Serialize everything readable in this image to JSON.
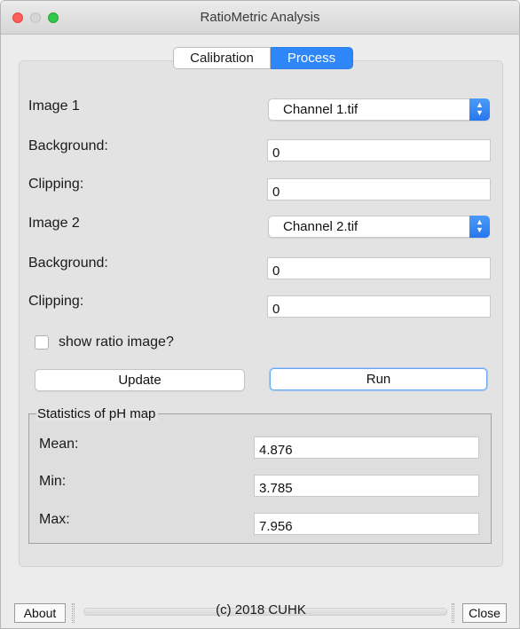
{
  "window": {
    "title": "RatioMetric Analysis"
  },
  "tabs": [
    {
      "label": "Calibration",
      "selected": false
    },
    {
      "label": "Process",
      "selected": true
    }
  ],
  "image1": {
    "label": "Image 1",
    "selected": "Channel 1.tif",
    "background_label": "Background:",
    "background_value": "0",
    "clipping_label": "Clipping:",
    "clipping_value": "0"
  },
  "image2": {
    "label": "Image 2",
    "selected": "Channel 2.tif",
    "background_label": "Background:",
    "background_value": "0",
    "clipping_label": "Clipping:",
    "clipping_value": "0"
  },
  "show_ratio": {
    "label": "show ratio image?",
    "checked": false
  },
  "buttons": {
    "update": "Update",
    "run": "Run",
    "about": "About",
    "close": "Close"
  },
  "stats": {
    "title": "Statistics of pH map",
    "mean_label": "Mean:",
    "mean_value": "4.876",
    "min_label": "Min:",
    "min_value": "3.785",
    "max_label": "Max:",
    "max_value": "7.956"
  },
  "status": {
    "copyright": "(c) 2018 CUHK",
    "progress_fraction": 0
  },
  "colors": {
    "accent": "#2f86f8",
    "close_light": "#fc5f57",
    "max_light": "#34c84a"
  }
}
